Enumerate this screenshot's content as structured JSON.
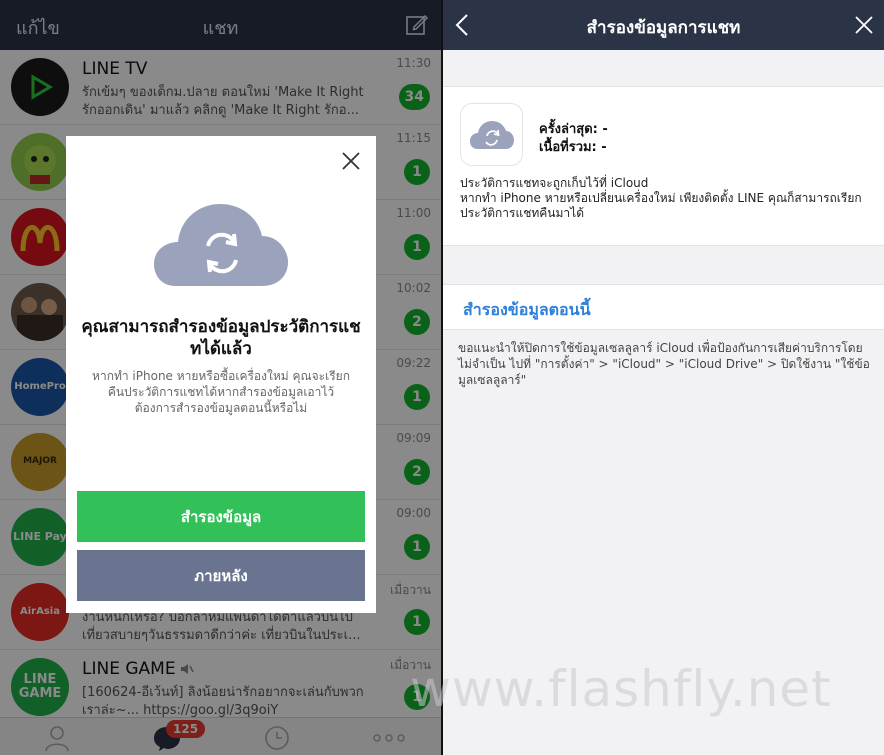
{
  "left_panel": {
    "header": {
      "edit_label": "แก้ไข",
      "title": "แชท"
    },
    "chats": [
      {
        "name": "LINE TV",
        "preview": "รักเข้มๆ ของเด็กม.ปลาย ตอนใหม่ 'Make It Right รักออกเดิน' มาแล้ว คลิกดู 'Make It Right รักอ...",
        "time": "11:30",
        "badge": "34",
        "avatar_color": "#1a1a1a"
      },
      {
        "name": "",
        "preview": "",
        "time": "11:15",
        "badge": "1",
        "avatar_color": "#8fce4b"
      },
      {
        "name": "",
        "preview": "",
        "time": "11:00",
        "badge": "1",
        "avatar_color": "#d8141f"
      },
      {
        "name": "",
        "preview": "",
        "time": "10:02",
        "badge": "2",
        "avatar_color": "#6d5c4c"
      },
      {
        "name": "",
        "preview": "",
        "time": "09:22",
        "badge": "1",
        "avatar_color": "#1b57a8",
        "avatar_text": "HomePro"
      },
      {
        "name": "",
        "preview": "",
        "time": "09:09",
        "badge": "2",
        "avatar_color": "#c89b2a",
        "avatar_text": "MAJOR"
      },
      {
        "name": "",
        "preview": "",
        "time": "09:00",
        "badge": "1",
        "avatar_color": "#21b24b",
        "avatar_text": "LINE Pay"
      },
      {
        "name": "",
        "preview": "งานหนักเหรอ? บอกลาหมีแพนด้าได้ตาแล้วบินไปเที่ยวสบายๆวันธรรมดาดีกว่าค่ะ เที่ยวบินในประเ...",
        "time": "เมื่อวาน",
        "badge": "1",
        "avatar_color": "#e52b24",
        "avatar_text": "AirAsia"
      },
      {
        "name": "LINE GAME",
        "preview": "[160624-อีเว้นท์] ลิงน้อยน่ารักอยากจะเล่นกับพวกเราล่ะ~... https://goo.gl/3q9oiY",
        "time": "เมื่อวาน",
        "badge": "1",
        "avatar_color": "#21b24b",
        "avatar_text": "LINE GAME"
      }
    ],
    "tabbar": {
      "chat_badge": "125"
    },
    "dialog": {
      "title": "คุณสามารถสำรองข้อมูลประวัติการแชทได้แล้ว",
      "description": "หากทำ iPhone หายหรือซื้อเครื่องใหม่ คุณจะเรียกคืนประวัติการแชทได้หากสำรองข้อมูลเอาไว้ ต้องการสำรองข้อมูลตอนนี้หรือไม่",
      "primary_button": "สำรองข้อมูล",
      "secondary_button": "ภายหลัง"
    }
  },
  "right_panel": {
    "header": {
      "title": "สำรองข้อมูลการแชท"
    },
    "card": {
      "last_backup": "ครั้งล่าสุด: -",
      "total_size": "เนื้อที่รวม: -",
      "desc_line1": "ประวัติการแชทจะถูกเก็บไว้ที่ iCloud",
      "desc_line2": "หากทำ iPhone หายหรือเปลี่ยนเครื่องใหม่ เพียงติดตั้ง LINE คุณก็สามารถเรียกประวัติการแชทคืนมาได้"
    },
    "backup_now_label": "สำรองข้อมูลตอนนี้",
    "note": "ขอแนะนำให้ปิดการใช้ข้อมูลเซลลูลาร์ iCloud เพื่อป้องกันการเสียค่าบริการโดยไม่จำเป็น ไปที่ \"การตั้งค่า\" > \"iCloud\" > \"iCloud Drive\" > ปิดใช้งาน \"ใช้ข้อมูลเซลลูลาร์\""
  },
  "watermark": "www.flashfly.net",
  "colors": {
    "header_bg": "#2b3347",
    "badge_green": "#13b52f",
    "primary_button": "#32c158",
    "secondary_button": "#6a7490",
    "link_blue": "#2d7fd8",
    "cloud": "#9aa3bb"
  }
}
